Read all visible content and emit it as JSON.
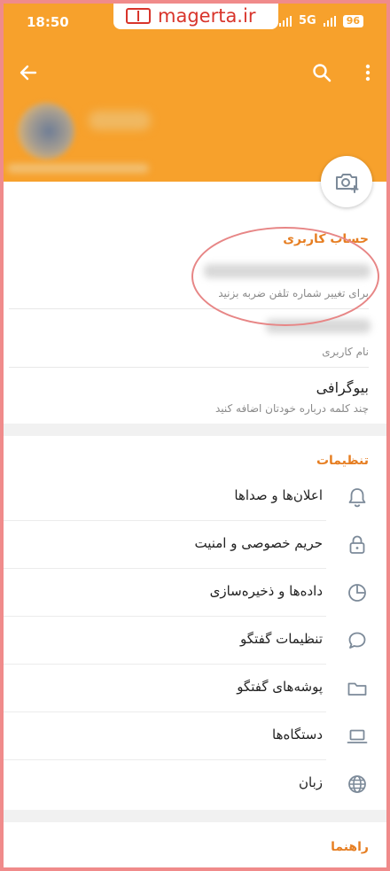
{
  "status_bar": {
    "time": "18:50",
    "network": "5G",
    "battery": "96"
  },
  "watermark": {
    "text": "magerta.ir"
  },
  "account": {
    "section_title": "حساب کاربری",
    "phone_hint": "برای تغییر شماره تلفن ضربه بزنید",
    "username_label": "نام کاربری",
    "bio_title": "بیوگرافی",
    "bio_hint": "چند کلمه درباره خودتان اضافه کنید"
  },
  "settings": {
    "section_title": "تنظیمات",
    "items": [
      {
        "label": "اعلان‌ها و صداها",
        "icon": "bell-icon"
      },
      {
        "label": "حریم خصوصی و امنیت",
        "icon": "lock-icon"
      },
      {
        "label": "داده‌ها و ذخیره‌سازی",
        "icon": "pie-chart-icon"
      },
      {
        "label": "تنظیمات گفتگو",
        "icon": "chat-bubble-icon"
      },
      {
        "label": "پوشه‌های گفتگو",
        "icon": "folder-icon"
      },
      {
        "label": "دستگاه‌ها",
        "icon": "laptop-icon"
      },
      {
        "label": "زبان",
        "icon": "globe-icon"
      }
    ]
  },
  "help": {
    "section_title": "راهنما"
  },
  "colors": {
    "accent": "#f7a12c",
    "section_title": "#e67e22",
    "highlight": "#e78686"
  }
}
